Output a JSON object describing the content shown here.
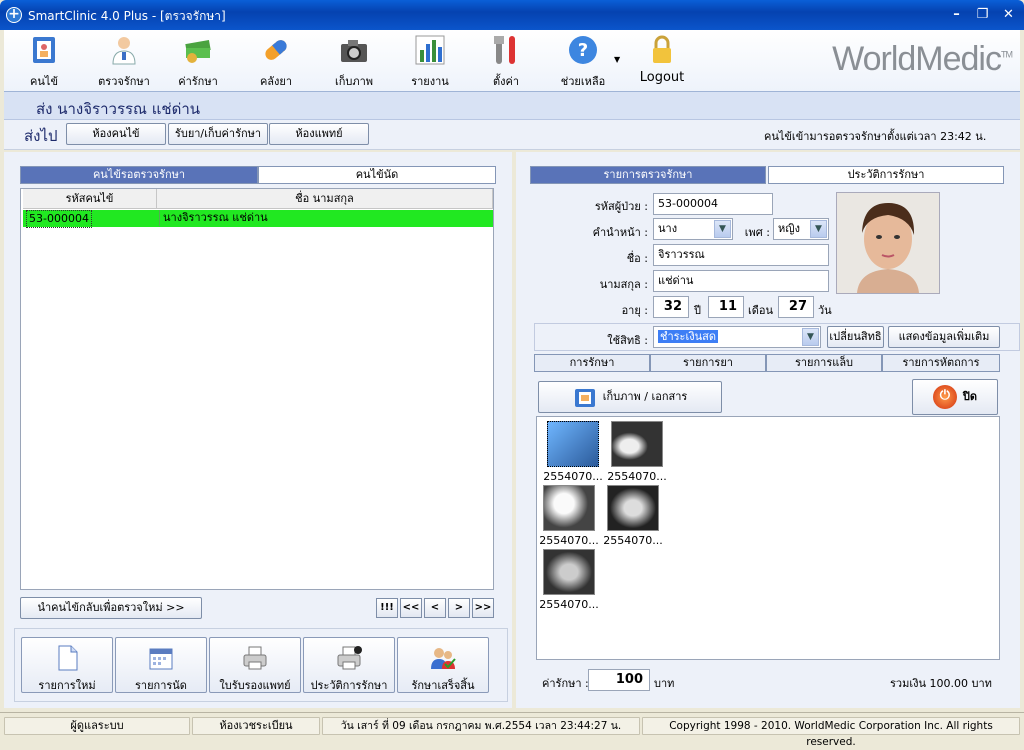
{
  "window": {
    "title": "SmartClinic 4.0 Plus - [ตรวจรักษา]"
  },
  "toolbar": {
    "items": [
      {
        "label": "คนไข้",
        "icon": "patient-folder-icon"
      },
      {
        "label": "ตรวจรักษา",
        "icon": "doctor-icon"
      },
      {
        "label": "ค่ารักษา",
        "icon": "money-icon"
      },
      {
        "label": "คลังยา",
        "icon": "capsule-icon"
      },
      {
        "label": "เก็บภาพ",
        "icon": "camera-icon"
      },
      {
        "label": "รายงาน",
        "icon": "bar-chart-icon"
      },
      {
        "label": "ตั้งค่า",
        "icon": "tools-icon"
      },
      {
        "label": "ช่วยเหลือ",
        "icon": "help-icon"
      },
      {
        "label": "Logout",
        "icon": "lock-icon"
      }
    ],
    "logo": "WorldMedic",
    "logo_tm": "TM"
  },
  "patient_header": "ส่ง  นางจิราวรรณ แช่ด่าน",
  "nav": {
    "label": "ส่งไป",
    "buttons": [
      "ห้องคนไข้",
      "รับยา/เก็บค่ารักษา",
      "ห้องแพทย์"
    ],
    "status": "คนไข้เข้ามารอตรวจรักษาตั้งแต่เวลา 23:42 น."
  },
  "left": {
    "tabs": [
      "คนไข้รอตรวจรักษา",
      "คนไข้นัด"
    ],
    "columns": [
      "รหัสคนไข้",
      "ชื่อ นามสกุล"
    ],
    "rows": [
      {
        "id": "53-000004",
        "name": "นางจิราวรรณ แช่ด่าน"
      }
    ],
    "return_button": "นำคนไข้กลับเพื่อตรวจใหม่ >>",
    "pager": [
      "!!!",
      "<<",
      "<",
      ">",
      ">>"
    ],
    "actions": [
      {
        "label": "รายการใหม่",
        "icon": "new-document-icon"
      },
      {
        "label": "รายการนัด",
        "icon": "calendar-icon"
      },
      {
        "label": "ใบรับรองแพทย์",
        "icon": "printer-icon"
      },
      {
        "label": "ประวัติการรักษา",
        "icon": "printer-check-icon"
      },
      {
        "label": "รักษาเสร็จสิ้น",
        "icon": "users-check-icon"
      }
    ]
  },
  "right": {
    "tabs": [
      "รายการตรวจรักษา",
      "ประวัติการรักษา"
    ],
    "fields": {
      "hn_label": "รหัสผู้ป่วย :",
      "hn": "53-000004",
      "prefix_label": "คำนำหน้า :",
      "prefix": "นาง",
      "sex_label": "เพศ :",
      "sex": "หญิง",
      "fname_label": "ชื่อ :",
      "fname": "จิราวรรณ",
      "lname_label": "นามสกุล :",
      "lname": "แช่ด่าน",
      "age_label": "อายุ :",
      "age_y": "32",
      "y_unit": "ปี",
      "age_m": "11",
      "m_unit": "เดือน",
      "age_d": "27",
      "d_unit": "วัน",
      "right_label": "ใช้สิทธิ :",
      "right_value": "ชำระเงินสด",
      "change_right": "เปลี่ยนสิทธิ",
      "more_info": "แสดงข้อมูลเพิ่มเติม"
    },
    "subtabs": [
      "การรักษา",
      "รายการยา",
      "รายการแล็บ",
      "รายการหัตถการ"
    ],
    "image_button": "เก็บภาพ / เอกสาร",
    "close_button": "ปิด",
    "thumbnails": [
      "2554070...",
      "2554070...",
      "2554070...",
      "2554070...",
      "2554070..."
    ],
    "fee_label": "ค่ารักษา :",
    "fee": "100",
    "fee_unit": "บาท",
    "total": "รวมเงิน 100.00 บาท"
  },
  "status": {
    "user": "ผู้ดูแลระบบ",
    "room": "ห้องเวชระเบียน",
    "datetime": "วัน เสาร์ ที่ 09 เดือน กรกฎาคม พ.ศ.2554 เวลา 23:44:27 น.",
    "copyright": "Copyright 1998 - 2010. WorldMedic Corporation Inc. All rights reserved."
  },
  "colors": {
    "titlebar": "#0A5FD8",
    "active_tab": "#5973B8",
    "selected_row": "#21E821",
    "right_selected": "#3D7EF5"
  }
}
